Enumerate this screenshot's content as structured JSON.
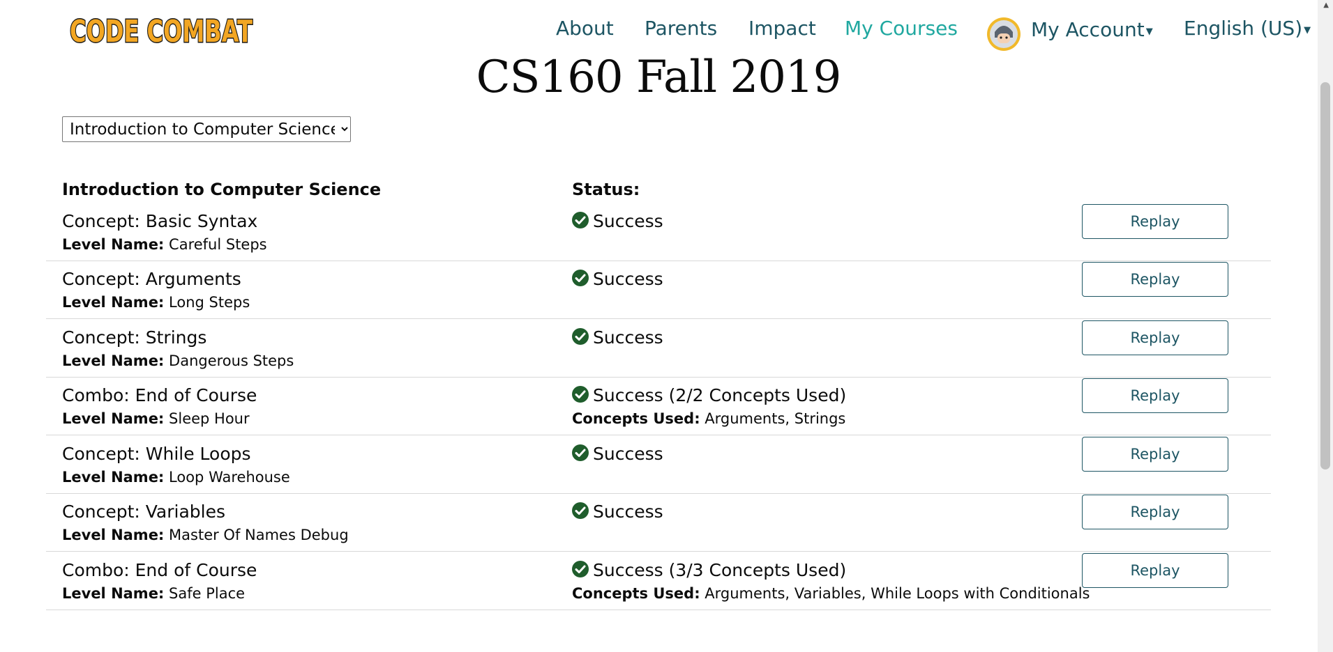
{
  "header": {
    "logo_text": "CODE COMBAT",
    "nav": [
      {
        "label": "About"
      },
      {
        "label": "Parents"
      },
      {
        "label": "Impact"
      },
      {
        "label": "My Courses"
      }
    ],
    "account_label": "My Account",
    "language_label": "English (US)"
  },
  "page": {
    "title": "CS160 Fall 2019",
    "course_select_value": "Introduction to Computer Science"
  },
  "table": {
    "course_heading": "Introduction to Computer Science",
    "status_heading": "Status:",
    "level_name_label": "Level Name:",
    "concepts_used_label": "Concepts Used:",
    "replay_label": "Replay",
    "rows": [
      {
        "concept": "Concept: Basic Syntax",
        "level": "Careful Steps",
        "status": "Success",
        "used": ""
      },
      {
        "concept": "Concept: Arguments",
        "level": "Long Steps",
        "status": "Success",
        "used": ""
      },
      {
        "concept": "Concept: Strings",
        "level": "Dangerous Steps",
        "status": "Success",
        "used": ""
      },
      {
        "concept": "Combo: End of Course",
        "level": "Sleep Hour",
        "status": "Success (2/2 Concepts Used)",
        "used": "Arguments, Strings"
      },
      {
        "concept": "Concept: While Loops",
        "level": "Loop Warehouse",
        "status": "Success",
        "used": ""
      },
      {
        "concept": "Concept: Variables",
        "level": "Master Of Names Debug",
        "status": "Success",
        "used": ""
      },
      {
        "concept": "Combo: End of Course",
        "level": "Safe Place",
        "status": "Success (3/3 Concepts Used)",
        "used": "Arguments, Variables, While Loops with Conditionals"
      }
    ]
  },
  "colors": {
    "nav_text": "#1d5563",
    "nav_active": "#20a8a0",
    "success_check": "#1f5d2c"
  }
}
